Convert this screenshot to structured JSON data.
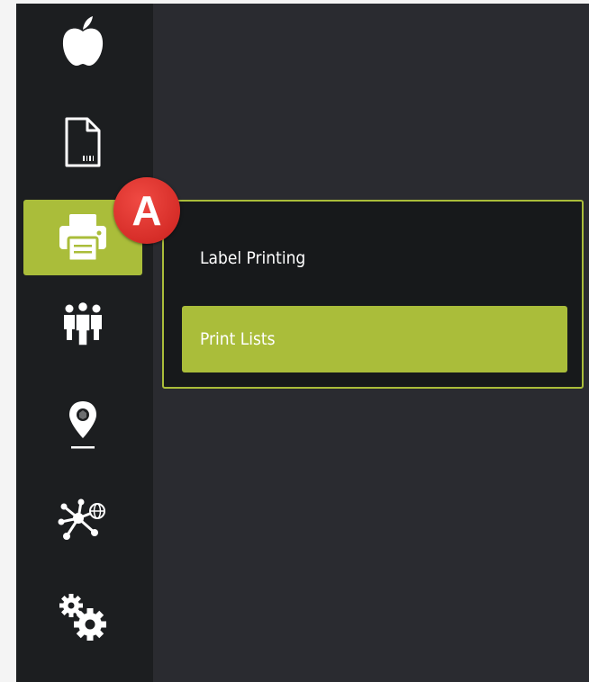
{
  "sidebar": {
    "items": [
      {
        "icon": "apple-icon",
        "active": false
      },
      {
        "icon": "document-barcode-icon",
        "active": false
      },
      {
        "icon": "printer-icon",
        "active": true
      },
      {
        "icon": "people-group-icon",
        "active": false
      },
      {
        "icon": "location-pin-icon",
        "active": false
      },
      {
        "icon": "network-nodes-icon",
        "active": false
      },
      {
        "icon": "gears-icon",
        "active": false
      }
    ]
  },
  "callout": {
    "letter": "A",
    "color": "#d9302a"
  },
  "submenu": {
    "items": [
      {
        "label": "Label Printing",
        "selected": false
      },
      {
        "label": "Print Lists",
        "selected": true
      }
    ]
  },
  "colors": {
    "accent": "#aabd3a",
    "sidebar_bg": "#1c1e20",
    "content_bg": "#2a2b30",
    "flyout_bg": "#17191b"
  }
}
